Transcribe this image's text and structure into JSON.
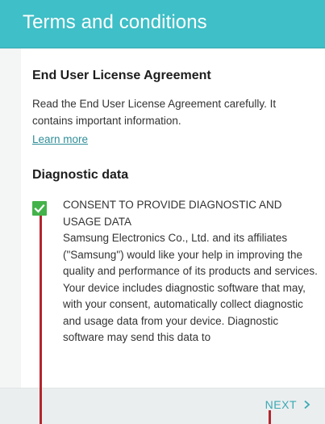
{
  "header": {
    "title": "Terms and conditions"
  },
  "eula": {
    "heading": "End User License Agreement",
    "body": "Read the End User License Agreement carefully. It contains important information.",
    "learn_more": "Learn more"
  },
  "diagnostic": {
    "heading": "Diagnostic data",
    "checked": true,
    "consent_title": "CONSENT TO PROVIDE DIAGNOSTIC AND USAGE DATA",
    "consent_body": "Samsung Electronics Co., Ltd. and its affiliates (\"Samsung\") would like your help in improving the quality and performance of its products and services. Your device includes diagnostic software that may, with your consent, automatically collect diagnostic and usage data from your device. Diagnostic software may send this data to"
  },
  "footer": {
    "next_label": "NEXT"
  },
  "colors": {
    "header": "#3fbfc7",
    "checkbox": "#43b24a",
    "link": "#2f8e98",
    "next": "#3aa9b3",
    "marker": "#b3262d"
  },
  "icons": {
    "checkbox": "check-icon",
    "next": "chevron-right-icon"
  }
}
